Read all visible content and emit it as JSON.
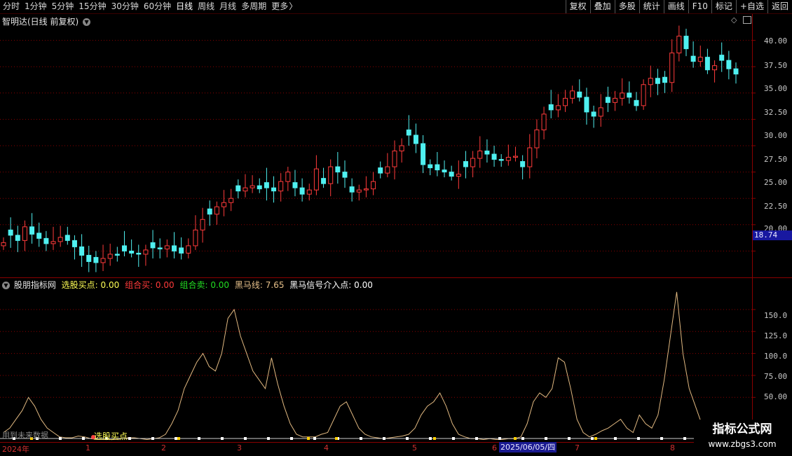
{
  "toolbar": {
    "periods": [
      "分时",
      "1分钟",
      "5分钟",
      "15分钟",
      "30分钟",
      "60分钟",
      "日线",
      "周线",
      "月线",
      "多周期",
      "更多"
    ],
    "more_arrow": "〉",
    "tools": [
      "复权",
      "叠加",
      "多股",
      "统计",
      "画线",
      "F10",
      "标记",
      "+自选",
      "返回"
    ]
  },
  "main_panel": {
    "title": "智明达(日线 前复权)",
    "price_ticks": [
      "40.00",
      "37.50",
      "35.00",
      "32.50",
      "30.00",
      "27.50",
      "25.00",
      "22.50",
      "20.00"
    ],
    "current_price_tag": "18.74"
  },
  "indicator_panel": {
    "name": "股朋指标网",
    "values": [
      {
        "label": "选股买点: 0.00",
        "color": "#ffff55"
      },
      {
        "label": "组合买: 0.00",
        "color": "#ff3a3a"
      },
      {
        "label": "组合卖: 0.00",
        "color": "#22dd22"
      },
      {
        "label": "黑马线: 7.65",
        "color": "#e6c08a"
      },
      {
        "label": "黑马信号介入点: 0.00",
        "color": "#ffffff"
      }
    ],
    "ticks": [
      "150.0",
      "125.0",
      "100.0",
      "75.00",
      "50.00"
    ],
    "bottom_texts": [
      "用到未来数据",
      "选股买点"
    ]
  },
  "date_axis": {
    "labels": [
      "2024年",
      "1",
      "2",
      "3",
      "4",
      "5",
      "6",
      "7",
      "8"
    ],
    "cursor_date": "2025/06/05/四"
  },
  "watermark": {
    "line1": "指标公式网",
    "line2": "www.zbgs3.com"
  },
  "colors": {
    "up": "#ff3b3b",
    "down": "#4ff0f0",
    "grid": "#8a0000",
    "indicator_line": "#e0b880"
  },
  "chart_data": [
    {
      "type": "candlestick",
      "title": "智明达(日线 前复权)",
      "ylim": [
        17.5,
        42.5
      ],
      "y_ticks": [
        20,
        22.5,
        25,
        27.5,
        30,
        32.5,
        35,
        37.5,
        40
      ],
      "close_estimates": [
        20.8,
        21.5,
        21.0,
        22.3,
        21.6,
        21.2,
        20.7,
        20.9,
        21.3,
        21.0,
        20.4,
        19.6,
        19.0,
        18.9,
        19.3,
        19.7,
        19.6,
        20.0,
        19.8,
        19.7,
        20.1,
        20.3,
        20.2,
        20.5,
        20.0,
        19.8,
        20.5,
        22.0,
        23.0,
        23.5,
        24.2,
        24.6,
        25.0,
        25.7,
        26.0,
        26.2,
        25.9,
        26.0,
        25.7,
        26.6,
        27.5,
        26.0,
        25.4,
        25.8,
        27.8,
        26.4,
        28.0,
        27.5,
        27.0,
        25.6,
        25.8,
        25.9,
        26.6,
        27.4,
        28.0,
        29.5,
        30.0,
        31.0,
        30.2,
        28.2,
        27.9,
        27.7,
        27.5,
        27.1,
        27.3,
        28.0,
        28.8,
        29.5,
        29.2,
        28.7,
        28.6,
        28.9,
        29.0,
        28.0,
        29.8,
        31.5,
        33.0,
        33.4,
        33.8,
        34.5,
        35.2,
        34.6,
        33.2,
        32.8,
        33.6,
        34.1,
        34.5,
        35.0,
        34.6,
        33.8,
        35.8,
        36.4,
        35.9,
        36.0,
        38.8,
        40.4,
        39.2,
        38.0,
        38.4,
        37.2,
        37.6,
        38.1,
        37.3,
        36.8
      ]
    },
    {
      "type": "line",
      "name": "黑马线",
      "ylim": [
        0,
        185
      ],
      "y_ticks": [
        50,
        75,
        100,
        125,
        150
      ],
      "values": [
        10,
        15,
        25,
        35,
        50,
        40,
        25,
        15,
        10,
        5,
        4,
        4,
        6,
        5,
        3,
        2,
        2,
        2,
        2,
        3,
        4,
        4,
        3,
        2,
        3,
        4,
        8,
        20,
        35,
        60,
        75,
        90,
        100,
        85,
        80,
        100,
        140,
        150,
        120,
        100,
        80,
        70,
        60,
        95,
        65,
        40,
        20,
        8,
        5,
        5,
        5,
        8,
        10,
        25,
        40,
        45,
        30,
        15,
        8,
        5,
        4,
        3,
        4,
        5,
        6,
        8,
        15,
        30,
        40,
        45,
        55,
        40,
        20,
        8,
        5,
        3,
        3,
        2,
        3,
        2,
        2,
        3,
        3,
        5,
        20,
        45,
        55,
        50,
        60,
        95,
        90,
        60,
        25,
        10,
        5,
        8,
        12,
        15,
        20,
        25,
        15,
        10,
        30,
        20,
        15,
        30,
        70,
        120,
        170,
        100,
        60,
        40,
        20,
        8
      ]
    }
  ]
}
